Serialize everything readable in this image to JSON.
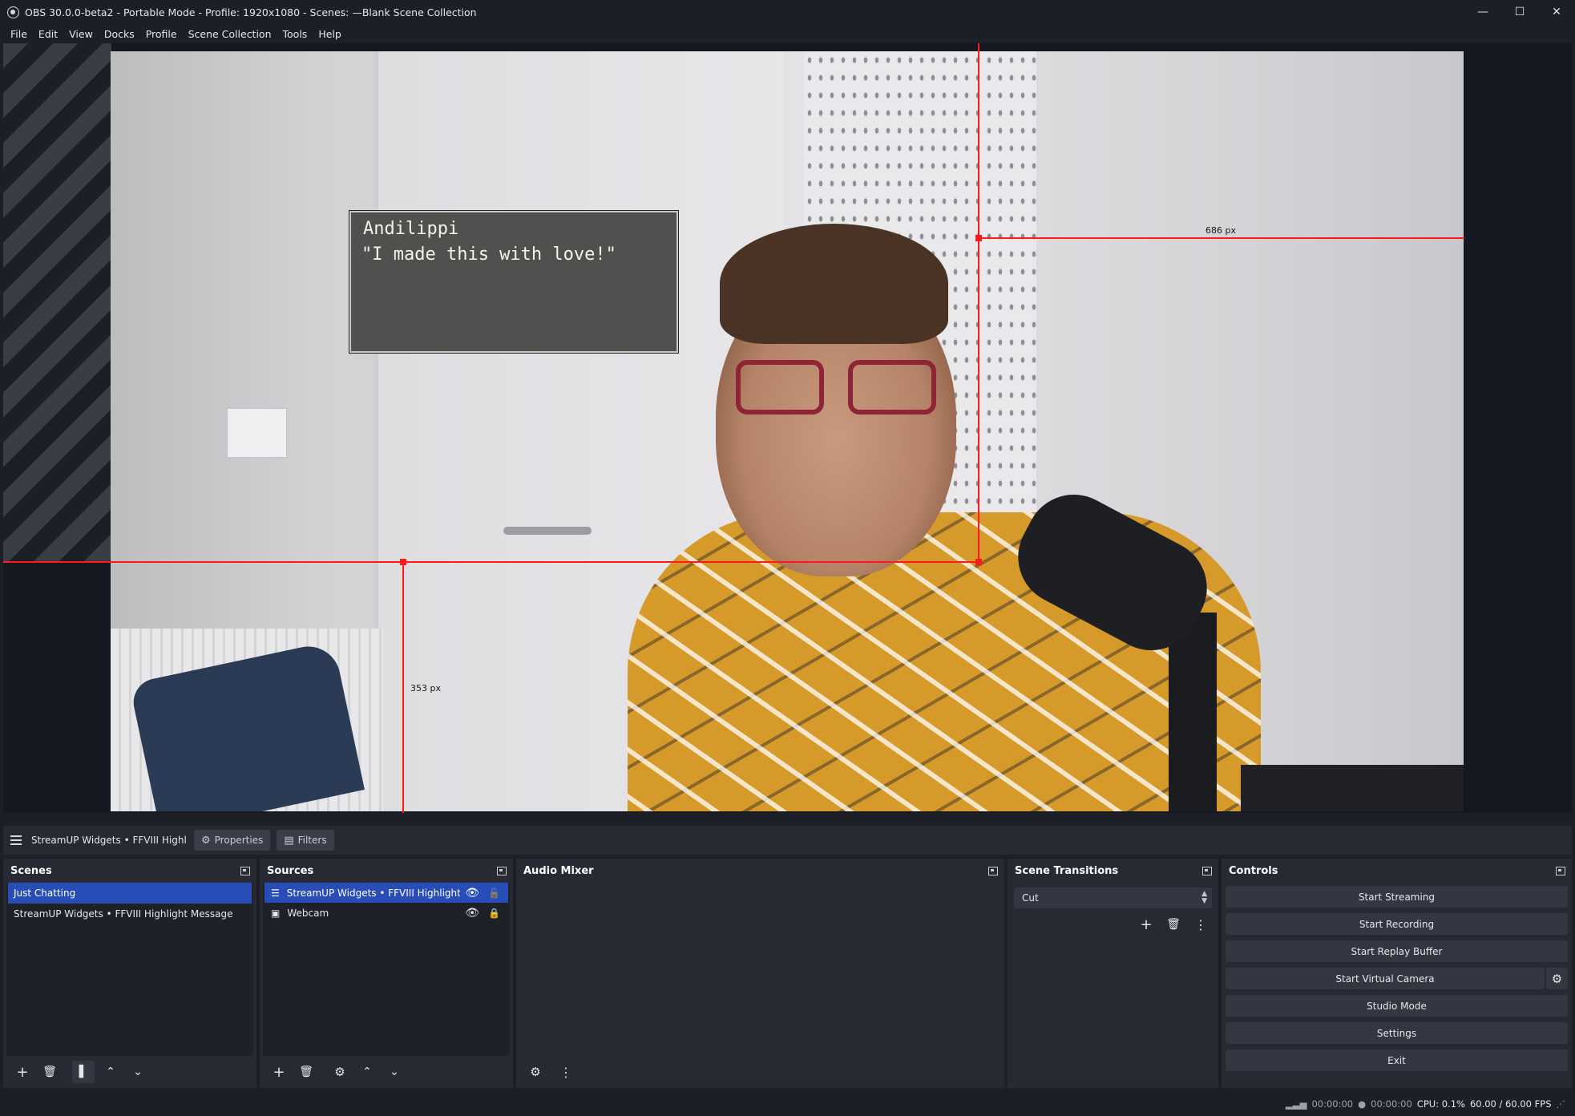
{
  "window": {
    "title": "OBS 30.0.0-beta2 - Portable Mode - Profile: 1920x1080 - Scenes: —Blank Scene Collection",
    "controls": {
      "minimize": "—",
      "maximize": "☐",
      "close": "✕"
    }
  },
  "menu": [
    "File",
    "Edit",
    "View",
    "Docks",
    "Profile",
    "Scene Collection",
    "Tools",
    "Help"
  ],
  "preview": {
    "widget_name": "Andilippi",
    "widget_message": "\"I made this with love!\"",
    "guide_right_label": "686 px",
    "guide_bottom_label": "353 px"
  },
  "context_bar": {
    "source_name": "StreamUP Widgets • FFVIII Highlight Message",
    "properties_label": "Properties",
    "filters_label": "Filters"
  },
  "scenes": {
    "title": "Scenes",
    "items": [
      "Just Chatting",
      "StreamUP Widgets • FFVIII Highlight Message"
    ],
    "selected_index": 0
  },
  "sources": {
    "title": "Sources",
    "items": [
      {
        "name": "StreamUP Widgets • FFVIII Highlight Message",
        "icon": "list-icon",
        "visible": true,
        "locked": false
      },
      {
        "name": "Webcam",
        "icon": "image-icon",
        "visible": true,
        "locked": true
      }
    ],
    "selected_index": 0
  },
  "audio_mixer": {
    "title": "Audio Mixer"
  },
  "scene_transitions": {
    "title": "Scene Transitions",
    "selected": "Cut"
  },
  "controls": {
    "title": "Controls",
    "buttons": [
      "Start Streaming",
      "Start Recording",
      "Start Replay Buffer",
      "Start Virtual Camera",
      "Studio Mode",
      "Settings",
      "Exit"
    ]
  },
  "status": {
    "stream_time": "00:00:00",
    "record_time": "00:00:00",
    "cpu": "CPU: 0.1%",
    "fps": "60.00 / 60.00 FPS"
  },
  "colors": {
    "accent_selection": "#284cb8",
    "dock_bg": "#272a33",
    "window_bg": "#1d1f26",
    "guide_red": "#ff1a1a"
  }
}
